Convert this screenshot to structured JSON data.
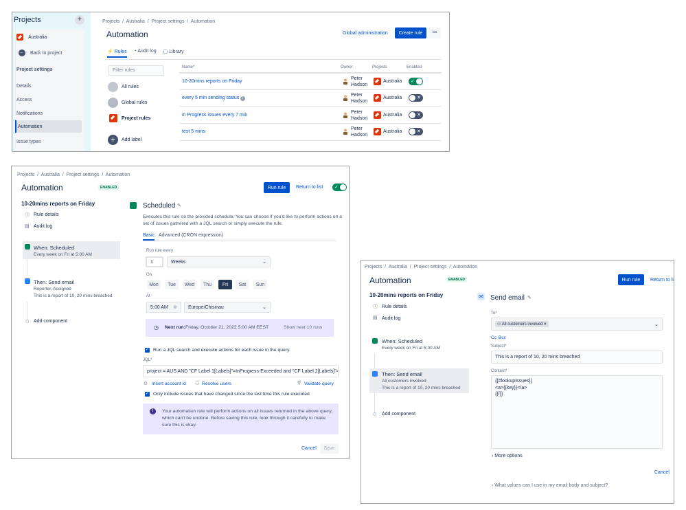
{
  "panel1": {
    "sidebar": {
      "title": "Projects",
      "plus": "+",
      "project": "Australia",
      "back": "Back to project",
      "section": "Project settings",
      "items": [
        "Details",
        "Access",
        "Notifications",
        "Automation",
        "Issue types"
      ]
    },
    "breadcrumb": "Projects  /  Australia  /  Project settings  /  Automation",
    "title": "Automation",
    "global_admin": "Global administration",
    "create_rule": "Create rule",
    "more": "•••",
    "tabs": [
      "Rules",
      "Audit log",
      "Library"
    ],
    "filter_placeholder": "Filter rules",
    "filters": [
      "All rules",
      "Global rules",
      "Project rules"
    ],
    "add_label": "Add label",
    "columns": [
      "Name",
      "Owner",
      "Projects",
      "Enabled"
    ],
    "rows": [
      {
        "name": "10-20mins reports on Friday",
        "owner_first": "Peter",
        "owner_last": "Hadson",
        "project": "Australia",
        "enabled": true
      },
      {
        "name": "every 5 min sending status",
        "owner_first": "Peter",
        "owner_last": "Hadson",
        "project": "Australia",
        "enabled": false
      },
      {
        "name": "in Progress issues every 7 min",
        "owner_first": "Peter",
        "owner_last": "Hadson",
        "project": "Australia",
        "enabled": false
      },
      {
        "name": "test 5 mins",
        "owner_first": "Peter",
        "owner_last": "Hadson",
        "project": "Australia",
        "enabled": false
      }
    ]
  },
  "panel2": {
    "breadcrumb": "Projects  /  Australia  /  Project settings  /  Automation",
    "title": "Automation",
    "badge": "ENABLED",
    "run_rule": "Run rule",
    "return": "Return to list",
    "rule_name": "10-20mins reports on Friday",
    "rule_details": "Rule details",
    "audit_log": "Audit log",
    "when_title": "When: Scheduled",
    "when_sub": "Every week on Fri at 5:00 AM",
    "then_title": "Then: Send email",
    "then_sub1": "Reporter, Assignee",
    "then_sub2": "This is a report of 10, 20 mins breached",
    "add_component": "Add component",
    "sched_title": "Scheduled",
    "sched_desc": "Executes this rule on the provided schedule. You can choose if you'd like to perform actions on a set of issues gathered with a JQL search or simply execute the rule.",
    "tab_basic": "Basic",
    "tab_adv": "Advanced (CRON expression)",
    "run_every_label": "Run rule every",
    "run_every_value": "1",
    "period": "Weeks",
    "on_label": "On",
    "days": [
      "Mon",
      "Tue",
      "Wed",
      "Thu",
      "Fri",
      "Sat",
      "Sun"
    ],
    "selected_day": "Fri",
    "at_label": "At",
    "time": "5:00 AM",
    "timezone": "Europe/Chisinau",
    "next_run_label": "Next run:",
    "next_run_value": "Friday, October 21, 2022 5:00 AM EEST",
    "show_next": "Show next 10 runs",
    "jql_check": "Run a JQL search and execute actions for each issue in the query.",
    "jql_label": "JQL",
    "jql_value": "project = AUS AND \"CF Label 1[Labels]\"=InProgress-Exceeded and \"CF Label 2[Labels]\"=In",
    "insert_account": "Insert account id",
    "resolve_users": "Resolve users",
    "validate_query": "Validate query",
    "only_changed": "Only include issues that have changed since the last time this rule executed",
    "warning": "Your automation rule will perform actions on all issues returned in the above query, which can't be undone. Before saving this rule, look through it carefully to make sure this is okay.",
    "cancel": "Cancel",
    "save": "Save"
  },
  "panel3": {
    "breadcrumb": "Projects  /  Australia  /  Project settings  /  Automation",
    "title": "Automation",
    "badge": "ENABLED",
    "run_rule": "Run rule",
    "return": "Return to li",
    "rule_name": "10-20mins reports on Friday",
    "rule_details": "Rule details",
    "audit_log": "Audit log",
    "when_title": "When: Scheduled",
    "when_sub": "Every week on Fri at 5:00 AM",
    "then_title": "Then: Send email",
    "then_sub1": "All customers involved",
    "then_sub2": "This is a report of 10, 20 mins breached",
    "add_component": "Add component",
    "email_title": "Send email",
    "to_label": "To",
    "to_chip": "All customers involved",
    "cc": "Cc",
    "bcc": "Bcc",
    "subject_label": "Subject",
    "subject_value": "This is a report of 10, 20 mins breached",
    "content_label": "Content",
    "content_lines": [
      "{{#lookupIssues}}",
      "<a>{{key}}</a>",
      "{{/}}"
    ],
    "more_options": "More options",
    "cancel": "Cancel",
    "help": "What values can I use in my email body and subject?"
  },
  "colors": {
    "primary": "#0052cc",
    "green": "#00875a",
    "dark_toggle": "#42526e",
    "sidebar_bg": "#e6f6fa",
    "note_bg": "#eae6ff"
  }
}
